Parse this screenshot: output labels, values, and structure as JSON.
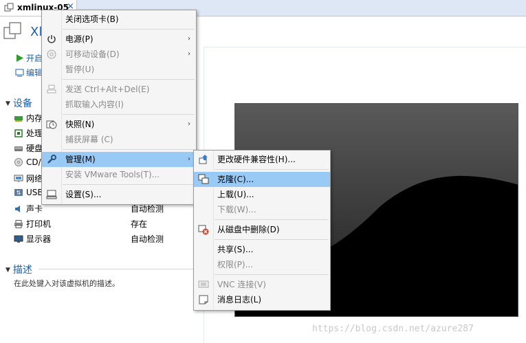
{
  "tab": {
    "label": "xmlinux-05",
    "close": "×"
  },
  "vm": {
    "title": "Xl",
    "commands": [
      {
        "label": "开启"
      },
      {
        "label": "编辑"
      }
    ]
  },
  "devices_section": {
    "title": "设备",
    "items": [
      {
        "name": "内存",
        "value": ""
      },
      {
        "name": "处理",
        "value": ""
      },
      {
        "name": "硬盘",
        "value": ""
      },
      {
        "name": "CD/",
        "value": ""
      },
      {
        "name": "网络",
        "value": ""
      },
      {
        "name": "USB",
        "value": ""
      },
      {
        "name": "声卡",
        "value": "自动检测"
      },
      {
        "name": "打印机",
        "value": "存在"
      },
      {
        "name": "显示器",
        "value": "自动检测"
      }
    ]
  },
  "description_section": {
    "title": "描述",
    "placeholder": "在此处键入对该虚拟机的描述。"
  },
  "context_menu": {
    "items": [
      {
        "label": "关闭选项卡(B)",
        "disabled": false
      },
      {
        "label": "电源(P)",
        "disabled": false,
        "submenu": true
      },
      {
        "label": "可移动设备(D)",
        "disabled": true,
        "submenu": true
      },
      {
        "label": "暂停(U)",
        "disabled": true
      },
      {
        "label": "发送 Ctrl+Alt+Del(E)",
        "disabled": true
      },
      {
        "label": "抓取输入内容(I)",
        "disabled": true
      },
      {
        "label": "快照(N)",
        "disabled": false,
        "submenu": true
      },
      {
        "label": "捕获屏幕 (C)",
        "disabled": true
      },
      {
        "label": "管理(M)",
        "disabled": false,
        "submenu": true,
        "highlighted": true
      },
      {
        "label": "安装 VMware Tools(T)...",
        "disabled": true
      },
      {
        "label": "设置(S)...",
        "disabled": false
      }
    ],
    "arrow": "›"
  },
  "manage_submenu": {
    "items": [
      {
        "label": "更改硬件兼容性(H)...",
        "disabled": false
      },
      {
        "label": "克隆(C)...",
        "disabled": false,
        "highlighted": true
      },
      {
        "label": "上载(U)...",
        "disabled": false
      },
      {
        "label": "下载(W)...",
        "disabled": true
      },
      {
        "label": "从磁盘中删除(D)",
        "disabled": false
      },
      {
        "label": "共享(S)...",
        "disabled": false
      },
      {
        "label": "权限(P)...",
        "disabled": true
      },
      {
        "label": "VNC 连接(V)",
        "disabled": true
      },
      {
        "label": "消息日志(L)",
        "disabled": false
      }
    ]
  },
  "watermark": "https://blog.csdn.net/azure287",
  "colors": {
    "accent": "#1a5fb4",
    "highlight": "#99c9f5",
    "tabbar": "#dde7f5"
  }
}
